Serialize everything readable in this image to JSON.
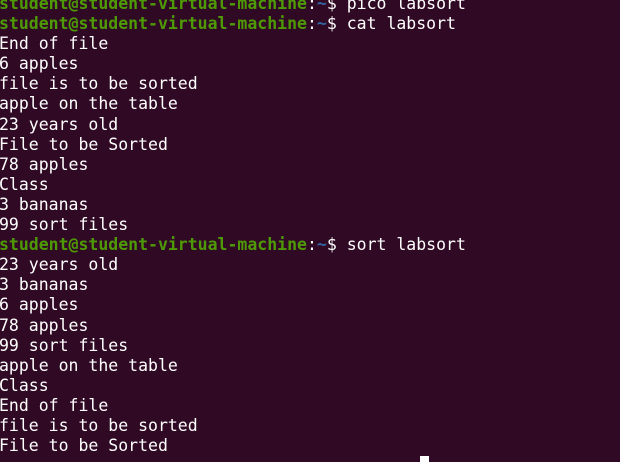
{
  "terminal": {
    "background_color": "#300a24",
    "prompt_user_color": "#4e9a06",
    "prompt_path_color": "#3465a4",
    "text_color": "#ffffff",
    "lines": [
      {
        "type": "prompt",
        "user": "student@student-virtual-machine",
        "sep": ":",
        "path": "~",
        "sym": "$ ",
        "cmd": "pico labsort"
      },
      {
        "type": "prompt",
        "user": "student@student-virtual-machine",
        "sep": ":",
        "path": "~",
        "sym": "$ ",
        "cmd": "cat labsort"
      },
      {
        "type": "output",
        "text": "End of file"
      },
      {
        "type": "output",
        "text": "6 apples"
      },
      {
        "type": "output",
        "text": "file is to be sorted"
      },
      {
        "type": "output",
        "text": "apple on the table"
      },
      {
        "type": "output",
        "text": "23 years old"
      },
      {
        "type": "output",
        "text": "File to be Sorted"
      },
      {
        "type": "output",
        "text": "78 apples"
      },
      {
        "type": "output",
        "text": "Class"
      },
      {
        "type": "output",
        "text": "3 bananas"
      },
      {
        "type": "output",
        "text": "99 sort files"
      },
      {
        "type": "prompt",
        "user": "student@student-virtual-machine",
        "sep": ":",
        "path": "~",
        "sym": "$ ",
        "cmd": "sort labsort"
      },
      {
        "type": "output",
        "text": "23 years old"
      },
      {
        "type": "output",
        "text": "3 bananas"
      },
      {
        "type": "output",
        "text": "6 apples"
      },
      {
        "type": "output",
        "text": "78 apples"
      },
      {
        "type": "output",
        "text": "99 sort files"
      },
      {
        "type": "output",
        "text": "apple on the table"
      },
      {
        "type": "output",
        "text": "Class"
      },
      {
        "type": "output",
        "text": "End of file"
      },
      {
        "type": "output",
        "text": "file is to be sorted"
      },
      {
        "type": "output",
        "text": "File to be Sorted"
      }
    ]
  }
}
